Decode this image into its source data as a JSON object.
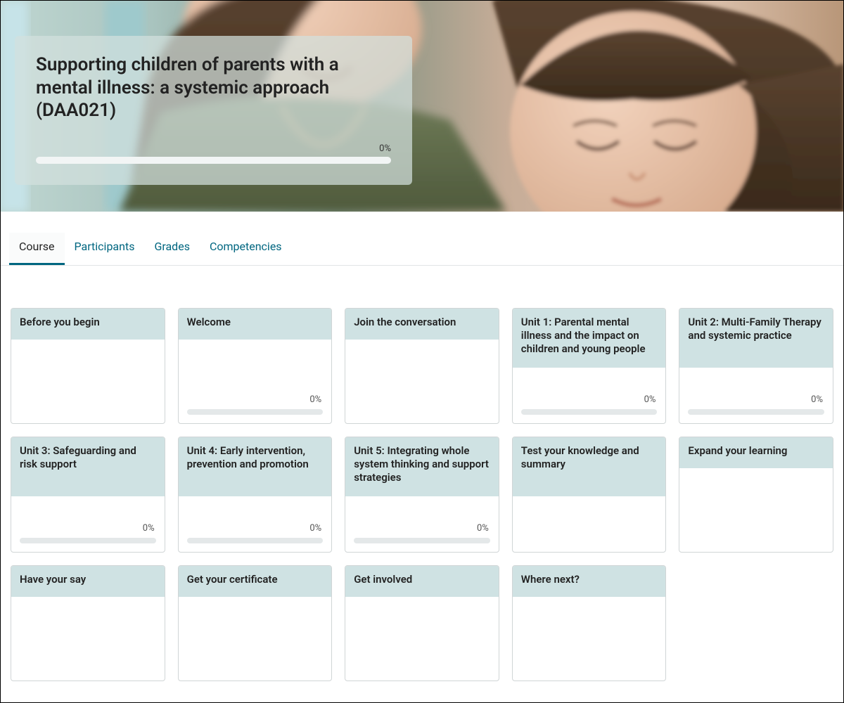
{
  "hero": {
    "title": "Supporting children of parents with a mental illness: a systemic approach (DAA021)",
    "progress_label": "0%"
  },
  "tabs": [
    {
      "label": "Course",
      "active": true
    },
    {
      "label": "Participants",
      "active": false
    },
    {
      "label": "Grades",
      "active": false
    },
    {
      "label": "Competencies",
      "active": false
    }
  ],
  "cards": [
    {
      "title": "Before you begin",
      "tall": false,
      "show_progress": false
    },
    {
      "title": "Welcome",
      "tall": false,
      "show_progress": true,
      "progress_label": "0%"
    },
    {
      "title": "Join the conversation",
      "tall": false,
      "show_progress": false
    },
    {
      "title": "Unit 1: Parental mental illness and the impact on children and young people",
      "tall": true,
      "show_progress": true,
      "progress_label": "0%"
    },
    {
      "title": "Unit 2: Multi-Family Therapy and systemic practice",
      "tall": true,
      "show_progress": true,
      "progress_label": "0%"
    },
    {
      "title": "Unit 3: Safeguarding and risk support",
      "tall": true,
      "show_progress": true,
      "progress_label": "0%"
    },
    {
      "title": "Unit 4: Early intervention, prevention and promotion",
      "tall": true,
      "show_progress": true,
      "progress_label": "0%"
    },
    {
      "title": "Unit 5: Integrating whole system thinking and support strategies",
      "tall": true,
      "show_progress": true,
      "progress_label": "0%"
    },
    {
      "title": "Test your knowledge and summary",
      "tall": true,
      "show_progress": false
    },
    {
      "title": "Expand your learning",
      "tall": false,
      "show_progress": false
    },
    {
      "title": "Have your say",
      "tall": false,
      "show_progress": false
    },
    {
      "title": "Get your certificate",
      "tall": false,
      "show_progress": false
    },
    {
      "title": "Get involved",
      "tall": false,
      "show_progress": false
    },
    {
      "title": "Where next?",
      "tall": false,
      "show_progress": false
    }
  ]
}
